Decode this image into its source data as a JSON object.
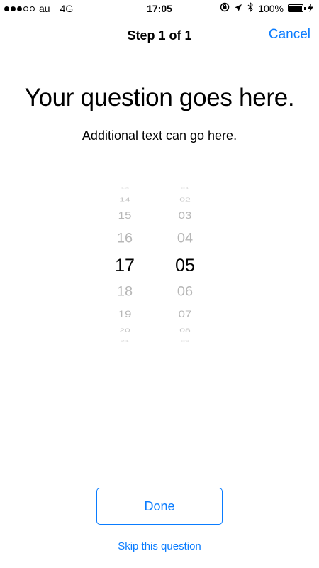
{
  "status_bar": {
    "carrier": "au",
    "network": "4G",
    "time": "17:05",
    "battery": "100%",
    "signal_bars_filled": 3,
    "signal_bars_total": 5,
    "icons": [
      "lock-rotation-icon",
      "location-arrow-icon",
      "bluetooth-icon",
      "battery-icon",
      "charging-bolt-icon"
    ]
  },
  "nav": {
    "title": "Step 1 of 1",
    "cancel_label": "Cancel"
  },
  "question": {
    "title": "Your question goes here.",
    "text": "Additional text can go here."
  },
  "picker": {
    "hours": [
      "13",
      "14",
      "15",
      "16",
      "17",
      "18",
      "19",
      "20",
      "21"
    ],
    "minutes": [
      "01",
      "02",
      "03",
      "04",
      "05",
      "06",
      "07",
      "08",
      "09"
    ],
    "selected_hour": "17",
    "selected_minute": "05"
  },
  "actions": {
    "done_label": "Done",
    "skip_label": "Skip this question"
  },
  "colors": {
    "accent": "#0a7cff",
    "picker_unselected": "#b7b7b7",
    "separator": "#cfcfcf"
  }
}
